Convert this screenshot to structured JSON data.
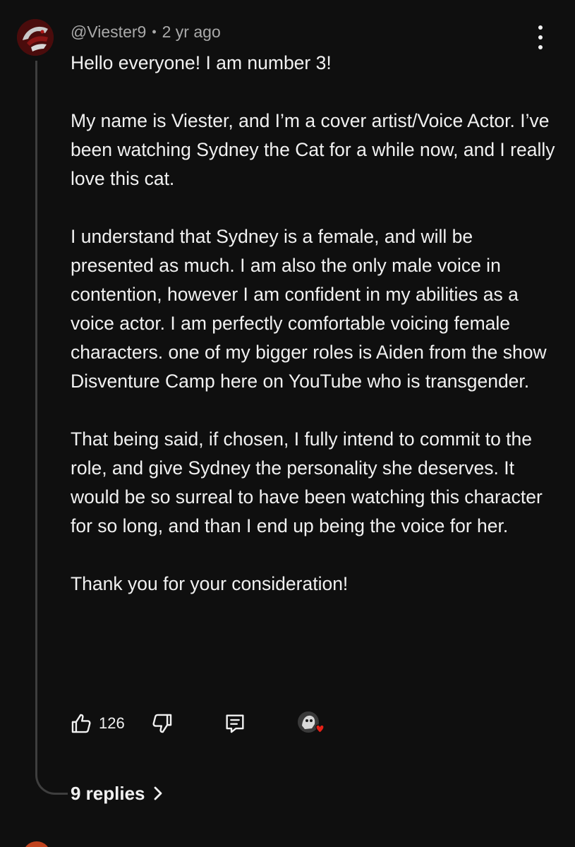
{
  "comment": {
    "author": "@Viester9",
    "separator": "•",
    "timestamp": "2 yr ago",
    "paragraphs": [
      "Hello everyone! I am number 3!",
      "My name is Viester, and I’m a cover artist/Voice Actor. I’ve been watching Sydney the Cat for a while now, and I really love this cat.",
      "I understand that Sydney is a female, and will be presented as much. I am also the only male voice in contention, however I am confident in my abilities as a voice actor. I am perfectly comfortable voicing female characters. one of my bigger roles is Aiden from the show Disventure Camp here on YouTube who is transgender.",
      "That being said, if chosen, I fully intend to commit to the role, and give Sydney the personality she deserves. It would be so surreal to have been watching this character for so long, and than I end up being the voice for her.",
      "Thank you for your consideration!"
    ],
    "like_count": "126",
    "replies_label": "9 replies"
  },
  "icons": {
    "like": "thumbs-up-icon",
    "dislike": "thumbs-down-icon",
    "reply": "comment-icon",
    "menu": "more-vertical-icon",
    "replies": "chevron-right-icon",
    "hearted": "creator-heart-icon"
  },
  "colors": {
    "background": "#0f0f0f",
    "text": "#f1f1f1",
    "secondary_text": "#aaaaaa",
    "thread_line": "#3e3e3e",
    "heart": "#e62117"
  }
}
